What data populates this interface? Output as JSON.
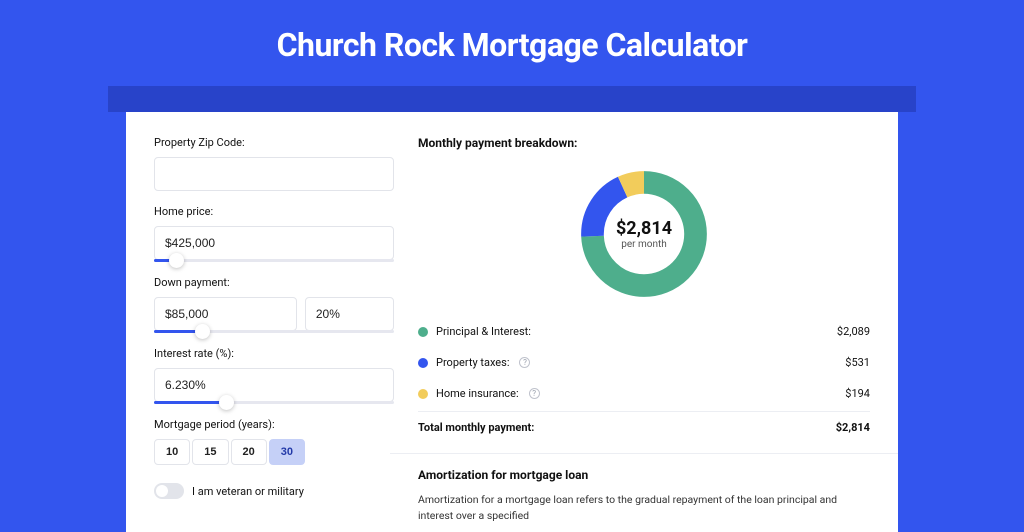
{
  "header": {
    "title": "Church Rock Mortgage Calculator"
  },
  "form": {
    "zip": {
      "label": "Property Zip Code:",
      "value": ""
    },
    "price": {
      "label": "Home price:",
      "value": "$425,000",
      "slider_pct": 9
    },
    "down": {
      "label": "Down payment:",
      "amount": "$85,000",
      "percent": "20%",
      "slider_pct": 20
    },
    "rate": {
      "label": "Interest rate (%):",
      "value": "6.230%",
      "slider_pct": 30
    },
    "period": {
      "label": "Mortgage period (years):",
      "options": [
        "10",
        "15",
        "20",
        "30"
      ],
      "selected": "30"
    },
    "veteran": {
      "label": "I am veteran or military",
      "on": false
    }
  },
  "breakdown": {
    "heading": "Monthly payment breakdown:",
    "center_amount": "$2,814",
    "center_sub": "per month",
    "items": [
      {
        "label": "Principal & Interest:",
        "value": "$2,089",
        "color": "#4eae8c",
        "info": false,
        "num": 2089
      },
      {
        "label": "Property taxes:",
        "value": "$531",
        "color": "#3355ee",
        "info": true,
        "num": 531
      },
      {
        "label": "Home insurance:",
        "value": "$194",
        "color": "#f2cc5b",
        "info": true,
        "num": 194
      }
    ],
    "total_label": "Total monthly payment:",
    "total_value": "$2,814"
  },
  "amortization": {
    "heading": "Amortization for mortgage loan",
    "text": "Amortization for a mortgage loan refers to the gradual repayment of the loan principal and interest over a specified"
  },
  "chart_data": {
    "type": "pie",
    "title": "Monthly payment breakdown",
    "series": [
      {
        "name": "Principal & Interest",
        "value": 2089,
        "color": "#4eae8c"
      },
      {
        "name": "Property taxes",
        "value": 531,
        "color": "#3355ee"
      },
      {
        "name": "Home insurance",
        "value": 194,
        "color": "#f2cc5b"
      }
    ],
    "total": 2814,
    "center_label": "$2,814 per month"
  }
}
